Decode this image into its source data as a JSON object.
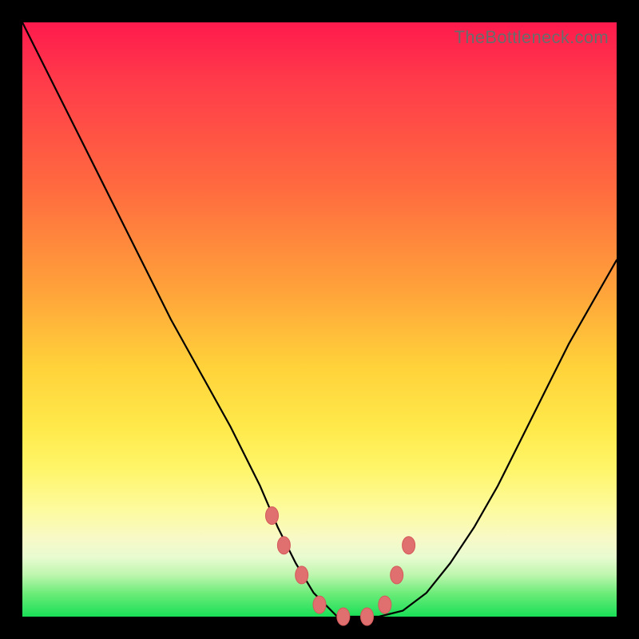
{
  "watermark": "TheBottleneck.com",
  "colors": {
    "frame": "#000000",
    "gradient_top": "#ff1a4d",
    "gradient_mid": "#ffe94a",
    "gradient_bottom": "#19df57",
    "marker": "#e06f6f",
    "line": "#000000"
  },
  "chart_data": {
    "type": "line",
    "title": "",
    "xlabel": "",
    "ylabel": "",
    "xlim": [
      0,
      100
    ],
    "ylim": [
      0,
      100
    ],
    "series": [
      {
        "name": "curve",
        "x": [
          0,
          5,
          10,
          15,
          20,
          25,
          30,
          35,
          40,
          43,
          46,
          49,
          52,
          53,
          56,
          60,
          64,
          68,
          72,
          76,
          80,
          84,
          88,
          92,
          96,
          100
        ],
        "values": [
          100,
          90,
          80,
          70,
          60,
          50,
          41,
          32,
          22,
          15,
          9,
          4,
          1,
          0,
          0,
          0,
          1,
          4,
          9,
          15,
          22,
          30,
          38,
          46,
          53,
          60
        ]
      }
    ],
    "markers": {
      "name": "highlight-points",
      "x": [
        42,
        44,
        47,
        50,
        54,
        58,
        61,
        63,
        65
      ],
      "values": [
        17,
        12,
        7,
        2,
        0,
        0,
        2,
        7,
        12
      ]
    }
  }
}
